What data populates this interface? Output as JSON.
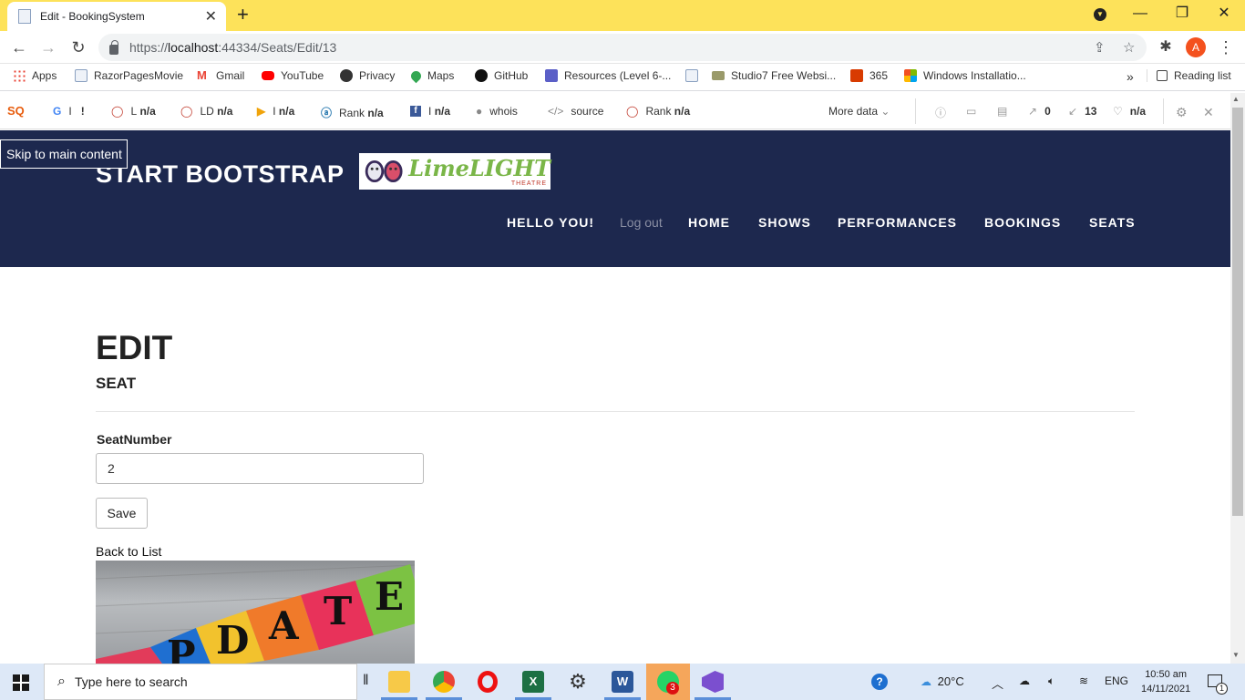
{
  "browser": {
    "tab_title": "Edit - BookingSystem",
    "url_prefix": "https://",
    "url_host": "localhost",
    "url_path": ":44334/Seats/Edit/13",
    "profile_initial": "A"
  },
  "bookmarks": {
    "items": [
      "Apps",
      "RazorPagesMovie",
      "Gmail",
      "YouTube",
      "Privacy",
      "Maps",
      "GitHub",
      "Resources (Level 6-...",
      "",
      "Studio7 Free Websi...",
      "365",
      "Windows Installatio..."
    ],
    "overflow": "»",
    "reading_list": "Reading list"
  },
  "seoquake": {
    "google": "I",
    "google2": "!",
    "l_label": "L",
    "l_value": "n/a",
    "ld_label": "LD",
    "ld_value": "n/a",
    "i_label": "I",
    "i_value": "n/a",
    "rank_label": "Rank",
    "rank_value": "n/a",
    "fb_label": "I",
    "fb_value": "n/a",
    "whois": "whois",
    "source": "source",
    "rank2_label": "Rank",
    "rank2_value": "n/a",
    "more_data": "More data",
    "ext_links": "0",
    "int_links": "13",
    "health": "n/a"
  },
  "page": {
    "skip_link": "Skip to main content",
    "brand": "START BOOTSTRAP",
    "logo_text": "LimeLIGHT",
    "logo_sub": "THEATRE",
    "nav": {
      "hello": "HELLO YOU!",
      "logout": "Log out",
      "home": "HOME",
      "shows": "SHOWS",
      "performances": "PERFORMANCES",
      "bookings": "BOOKINGS",
      "seats": "SEATS"
    },
    "title": "EDIT",
    "subtitle": "SEAT",
    "field_label": "SeatNumber",
    "field_value": "2",
    "save_label": "Save",
    "back_link": "Back to List",
    "image_letters": "PDATE"
  },
  "taskbar": {
    "search_placeholder": "Type here to search",
    "weather": "20°C",
    "lang": "ENG",
    "time": "10:50 am",
    "date": "14/11/2021",
    "whatsapp_badge": "3",
    "notif_badge": "1"
  },
  "colors": {
    "tab_strip": "#fde25a",
    "header_bg": "#1d284e",
    "taskbar": "#dde8f7"
  }
}
